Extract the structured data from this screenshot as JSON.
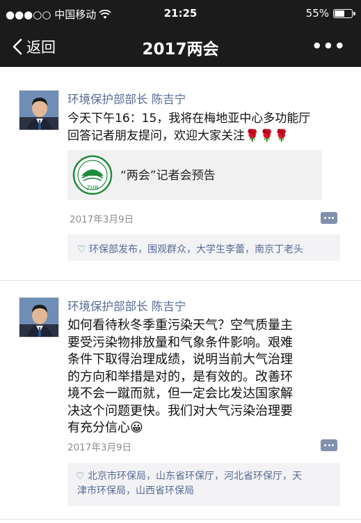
{
  "status_bar": {
    "carrier": "●●●○○ 中国移动",
    "time": "21:25",
    "battery": "55%",
    "battery_level": 0.55
  },
  "nav": {
    "back_label": "返回",
    "title": "2017两会",
    "more_label": "•••"
  },
  "posts": [
    {
      "author": "环境保护部部长 陈吉宁",
      "text_lines": [
        "今天下午16：15，我将在梅地亚中心多功能厅",
        "回答记者朋友提问，欢迎大家关注🌹🌹🌹"
      ],
      "share": {
        "logo_text": "ZHB",
        "title": "“两会”记者会预告"
      },
      "date": "2017年3月9日",
      "likes": "♡ 环保部发布，围观群众，大学生李蕾，南京丁老头"
    },
    {
      "author": "环境保护部部长 陈吉宁",
      "text_lines": [
        "如何看待秋冬季重污染天气？空气质量主",
        "要受污染物排放量和气象条件影响。艰难",
        "条件下取得治理成绩，说明当前大气治理",
        "的方向和举措是对的，是有效的。改善环",
        "境不会一蹴而就，但一定会比发达国家解",
        "决这个问题更快。我们对大气污染治理要",
        "有充分信心😀"
      ],
      "date": "2017年3月9日",
      "likes_lines": [
        "♡ 北京市环保局，山东省环保厅，河北省环保厅，天",
        "津市环保局，山西省环保局"
      ]
    }
  ]
}
